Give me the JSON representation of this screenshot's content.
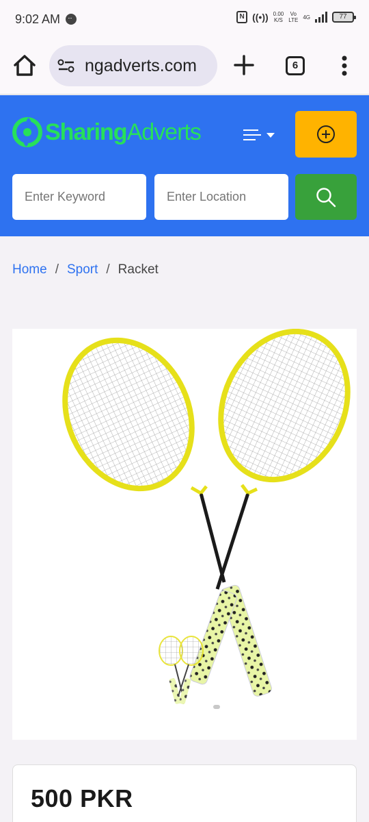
{
  "status_bar": {
    "time": "9:02 AM",
    "net_speed_value": "0.00",
    "net_speed_unit": "K/S",
    "volte_top": "Vo",
    "volte_bottom": "LTE",
    "network": "4G",
    "battery": "77"
  },
  "browser": {
    "url": "ngadverts.com",
    "tab_count": "6"
  },
  "header": {
    "logo_part1": "Sharing",
    "logo_part2": "Adverts",
    "keyword_placeholder": "Enter Keyword",
    "location_placeholder": "Enter Location",
    "brand_green": "#27e05a",
    "header_blue": "#2e72f0",
    "post_button_color": "#ffb300",
    "search_button_color": "#38a13b"
  },
  "breadcrumb": {
    "home": "Home",
    "sep": "/",
    "category": "Sport",
    "current": "Racket"
  },
  "listing": {
    "image_subject": "badminton rackets",
    "price": "500 PKR"
  }
}
